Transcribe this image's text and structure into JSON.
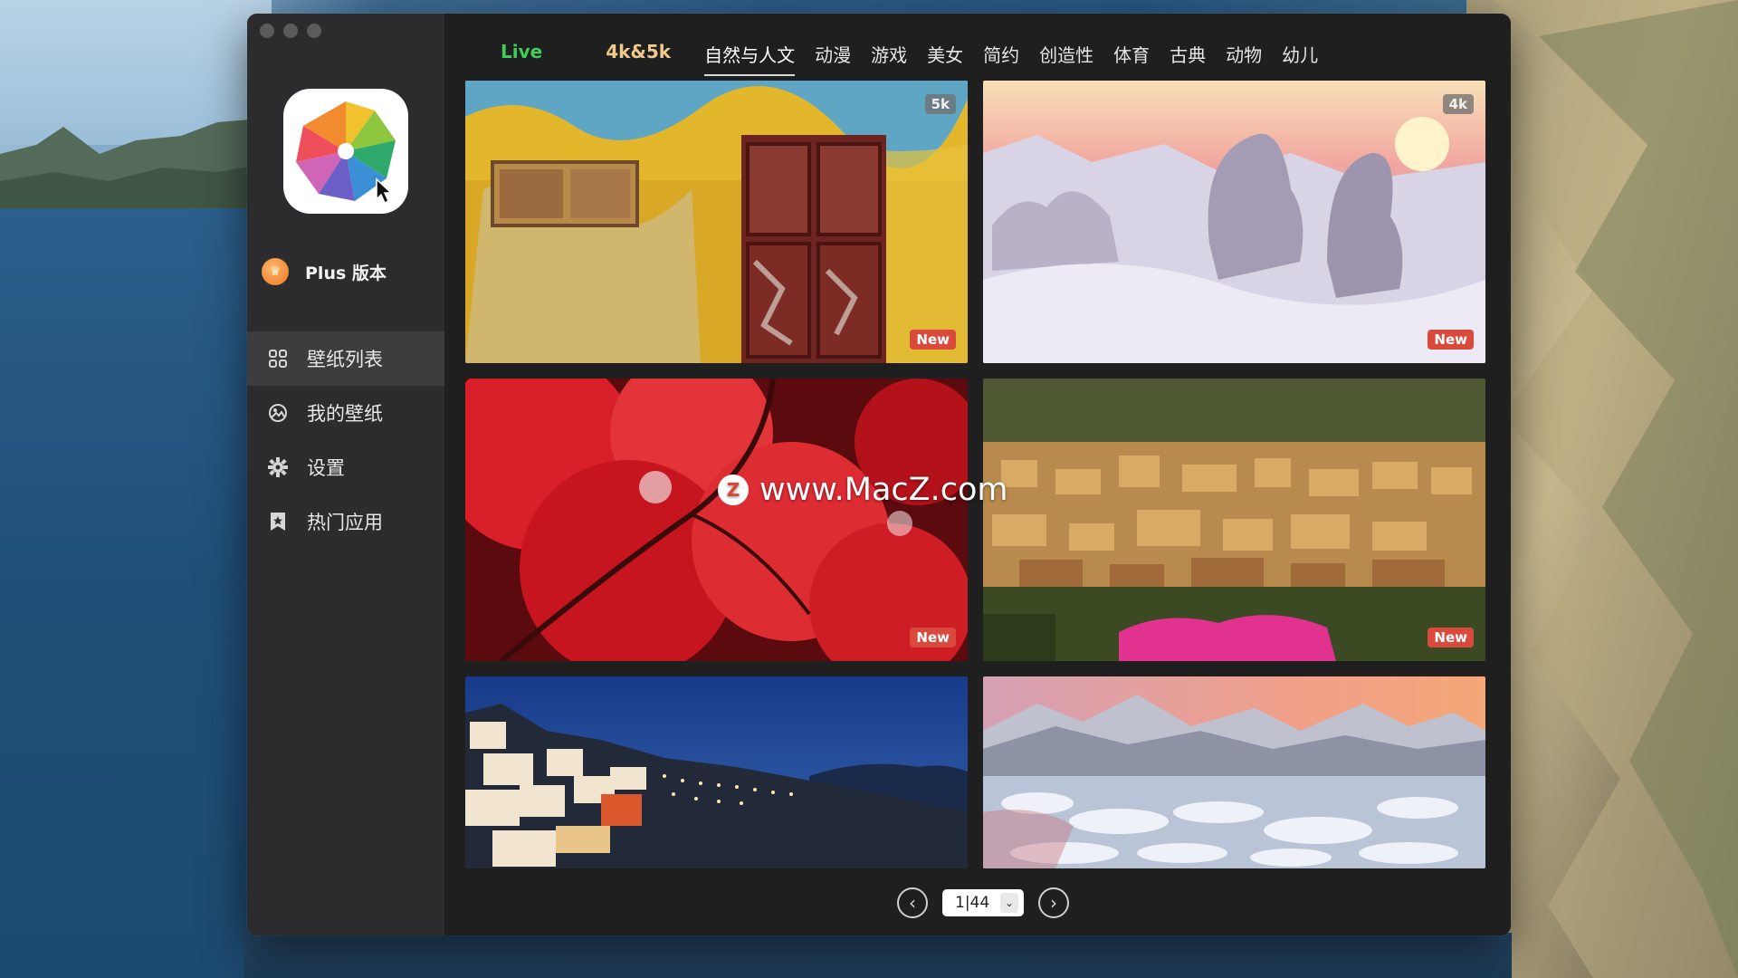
{
  "app": {
    "plus_label": "Plus 版本",
    "crown_icon": "crown-icon"
  },
  "sidebar": {
    "items": [
      {
        "label": "壁纸列表",
        "icon": "grid-icon",
        "active": true
      },
      {
        "label": "我的壁纸",
        "icon": "image-icon",
        "active": false
      },
      {
        "label": "设置",
        "icon": "gear-icon",
        "active": false
      },
      {
        "label": "热门应用",
        "icon": "bookmark-star-icon",
        "active": false
      }
    ]
  },
  "tabs": [
    {
      "label": "Live"
    },
    {
      "label": "4k&5k"
    },
    {
      "label": "自然与人文"
    },
    {
      "label": "动漫"
    },
    {
      "label": "游戏"
    },
    {
      "label": "美女"
    },
    {
      "label": "简约"
    },
    {
      "label": "创造性"
    },
    {
      "label": "体育"
    },
    {
      "label": "古典"
    },
    {
      "label": "动物"
    },
    {
      "label": "幼儿"
    }
  ],
  "active_tab": "自然与人文",
  "wallpapers": [
    {
      "subject": "yellow-wall-red-door",
      "resolution": "5k",
      "new_label": "New"
    },
    {
      "subject": "snow-sunset",
      "resolution": "4k",
      "new_label": "New"
    },
    {
      "subject": "red-maple-leaves",
      "new_label": "New"
    },
    {
      "subject": "hillside-town",
      "new_label": "New"
    },
    {
      "subject": "santorini-night"
    },
    {
      "subject": "snowy-mountains-sunset"
    }
  ],
  "pager": {
    "value": "1|44",
    "prev_icon": "chevron-left-icon",
    "next_icon": "chevron-right-icon"
  },
  "watermark": {
    "logo": "Z",
    "text": "www.MacZ.com"
  },
  "colors": {
    "live_tab": "#3ecf56",
    "k45_tab": "#f0c98b",
    "new_badge": "#d9493c",
    "sidebar_bg": "#2c2c2e",
    "main_bg": "#1f1f1f"
  }
}
